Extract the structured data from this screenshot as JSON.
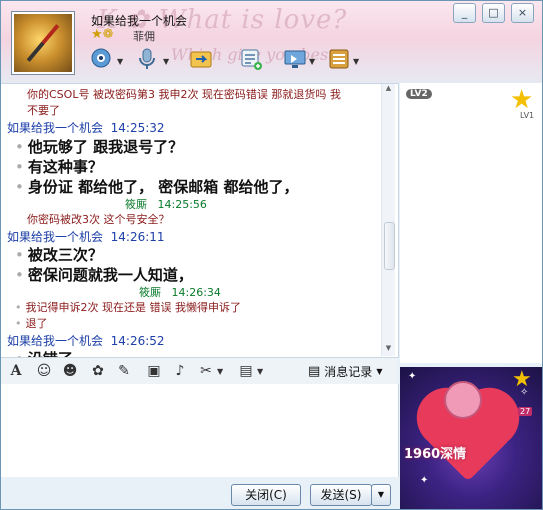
{
  "contact": {
    "name": "如果给我一个机会",
    "signature": "菲佣"
  },
  "window_buttons": {
    "minimize": "_",
    "maximize": "□",
    "close": "×"
  },
  "top_toolbar": {
    "icons": [
      "video-icon",
      "voice-icon",
      "file-transfer-icon",
      "group-chat-icon",
      "remote-assist-icon",
      "app-box-icon"
    ]
  },
  "messages": [
    {
      "type": "red",
      "text": "你的CSOL号 被改密码第3  我申2次 现在密码错误 那就退货吗 我"
    },
    {
      "type": "red",
      "text": "不要了"
    },
    {
      "type": "me",
      "sender": "如果给我一个机会",
      "time": "14:25:32"
    },
    {
      "type": "big",
      "text": "他玩够了 跟我退号了？"
    },
    {
      "type": "big",
      "text": "有这种事？"
    },
    {
      "type": "big",
      "text": "身份证 都给他了，  密保邮箱 都给他了，"
    },
    {
      "type": "other",
      "sender": "筱厮",
      "time": "14:25:56"
    },
    {
      "type": "red",
      "text": "你密码被改3次 这个号安全？"
    },
    {
      "type": "me",
      "sender": "如果给我一个机会",
      "time": "14:26:11"
    },
    {
      "type": "big",
      "text": "被改三次？"
    },
    {
      "type": "big",
      "text": "密保问题就我一人知道，"
    },
    {
      "type": "other",
      "sender": "筱厮",
      "time": "14:26:34"
    },
    {
      "type": "red",
      "text": "我记得申诉2次 现在还是 错误 我懒得申诉了"
    },
    {
      "type": "red",
      "text": "退了"
    },
    {
      "type": "me",
      "sender": "如果给我一个机会",
      "time": "14:26:52"
    },
    {
      "type": "big",
      "text": "沿错了"
    }
  ],
  "format_toolbar": {
    "history_label": "消息记录"
  },
  "buttons": {
    "close_label": "关闭(C)",
    "send_label": "发送(S)"
  },
  "right_panel": {
    "level_badge": "LV2",
    "star_label": "LV1",
    "show_banner": "1960深情",
    "show_count": "27"
  }
}
